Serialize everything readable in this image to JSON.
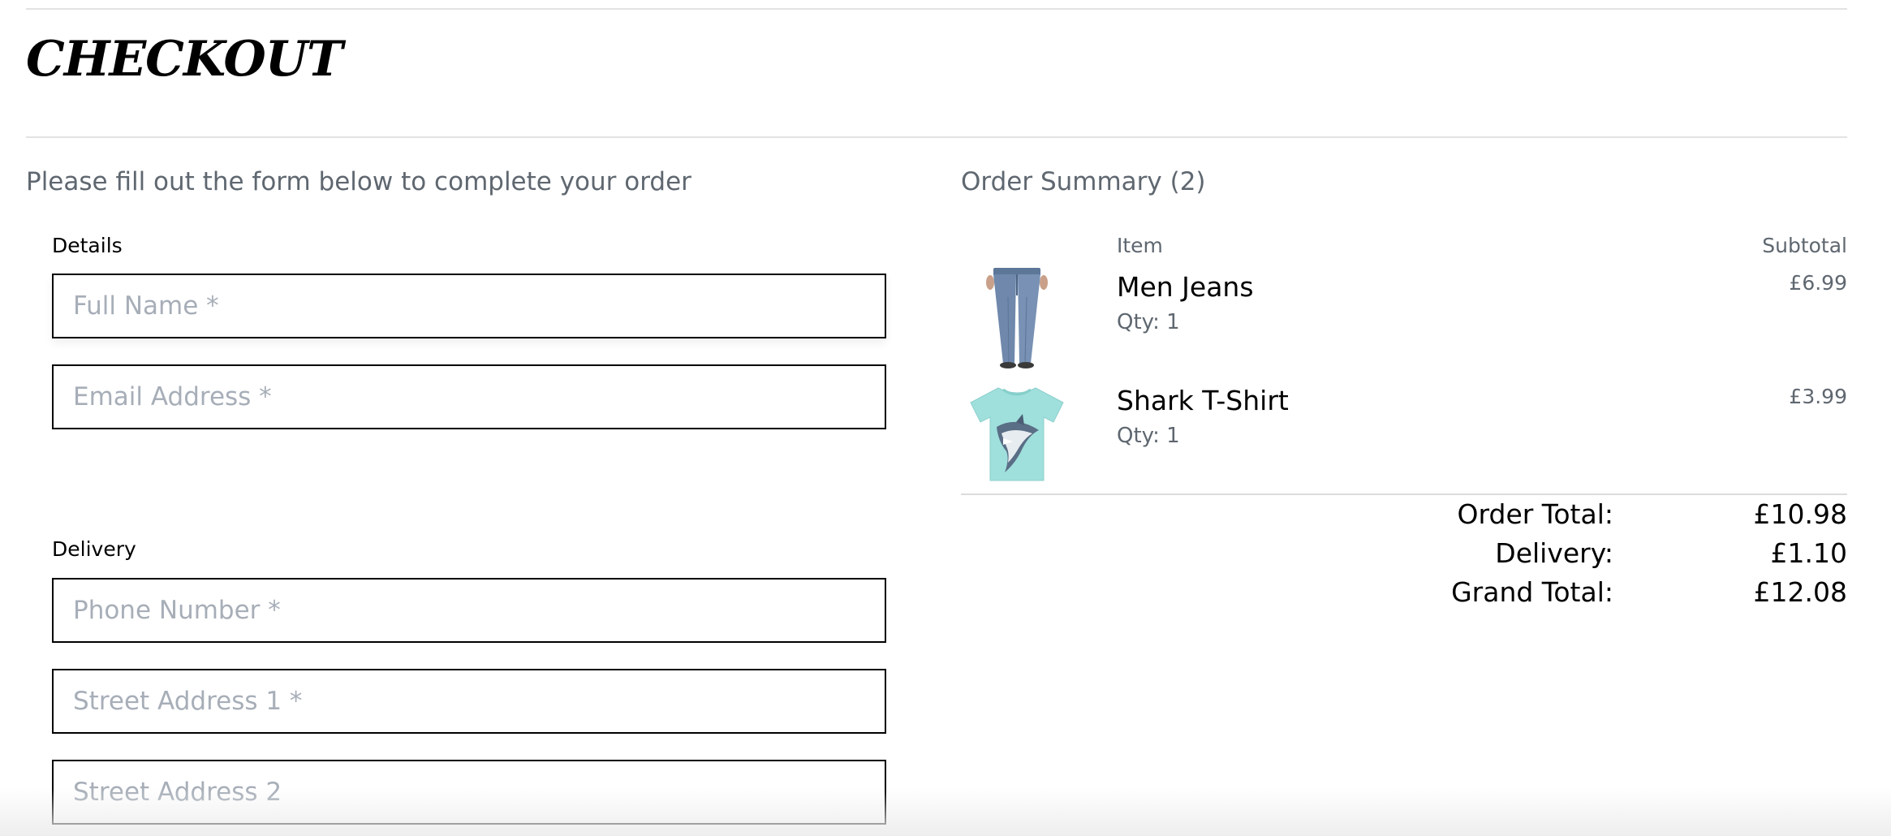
{
  "page": {
    "title": "CHECKOUT",
    "intro": "Please fill out the form below to complete your order"
  },
  "form": {
    "details_label": "Details",
    "delivery_label": "Delivery",
    "fields": {
      "full_name": {
        "placeholder": "Full Name *",
        "value": ""
      },
      "email": {
        "placeholder": "Email Address *",
        "value": ""
      },
      "phone": {
        "placeholder": "Phone Number *",
        "value": ""
      },
      "street1": {
        "placeholder": "Street Address 1 *",
        "value": ""
      },
      "street2": {
        "placeholder": "Street Address 2",
        "value": ""
      }
    }
  },
  "summary": {
    "title": "Order Summary (2)",
    "col_item": "Item",
    "col_subtotal": "Subtotal",
    "items": [
      {
        "name": "Men Jeans",
        "qty": "Qty: 1",
        "price": "£6.99",
        "image": "jeans-image"
      },
      {
        "name": "Shark T-Shirt",
        "qty": "Qty: 1",
        "price": "£3.99",
        "image": "shark-tshirt-image"
      }
    ],
    "totals": {
      "order_total_label": "Order Total:",
      "order_total": "£10.98",
      "delivery_label": "Delivery:",
      "delivery": "£1.10",
      "grand_total_label": "Grand Total:",
      "grand_total": "£12.08"
    }
  },
  "colors": {
    "text_muted": "#5f6770",
    "placeholder": "#a7aeb8",
    "border": "#000000",
    "rule": "#e3e3e3",
    "tshirt": "#9fdfdc",
    "jeans": "#6f88ac"
  }
}
